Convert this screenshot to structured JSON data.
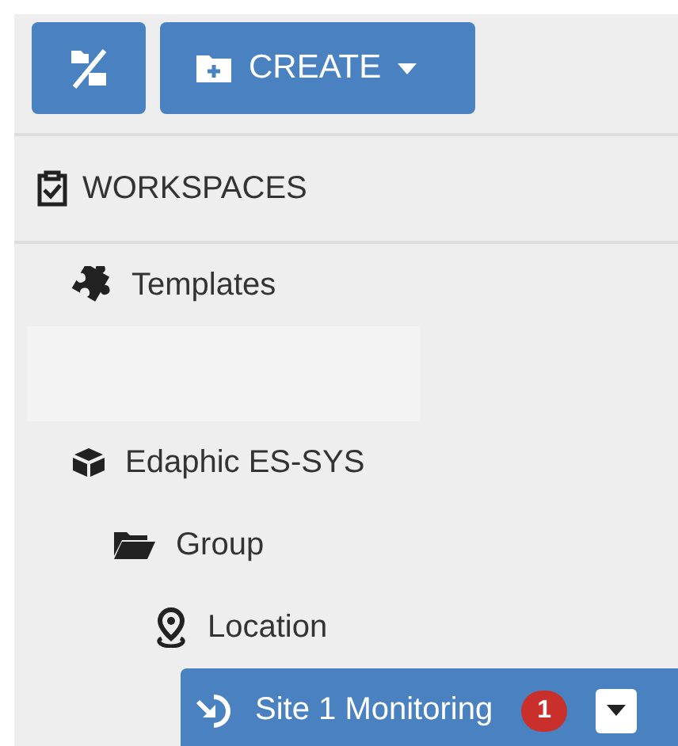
{
  "toolbar": {
    "create_button": {
      "label": "CREATE"
    }
  },
  "section": {
    "title": "WORKSPACES"
  },
  "tree": [
    {
      "label": "Templates",
      "kind": "templates",
      "selected": false
    },
    {
      "label": "Edaphic ES-SYS",
      "kind": "system",
      "selected": false,
      "children": [
        {
          "label": "Group",
          "kind": "group",
          "selected": false,
          "children": [
            {
              "label": "Location",
              "kind": "location",
              "selected": false,
              "children": [
                {
                  "label": "Site 1 Monitoring",
                  "kind": "site",
                  "selected": true,
                  "badge": "1"
                }
              ]
            }
          ]
        }
      ]
    }
  ]
}
